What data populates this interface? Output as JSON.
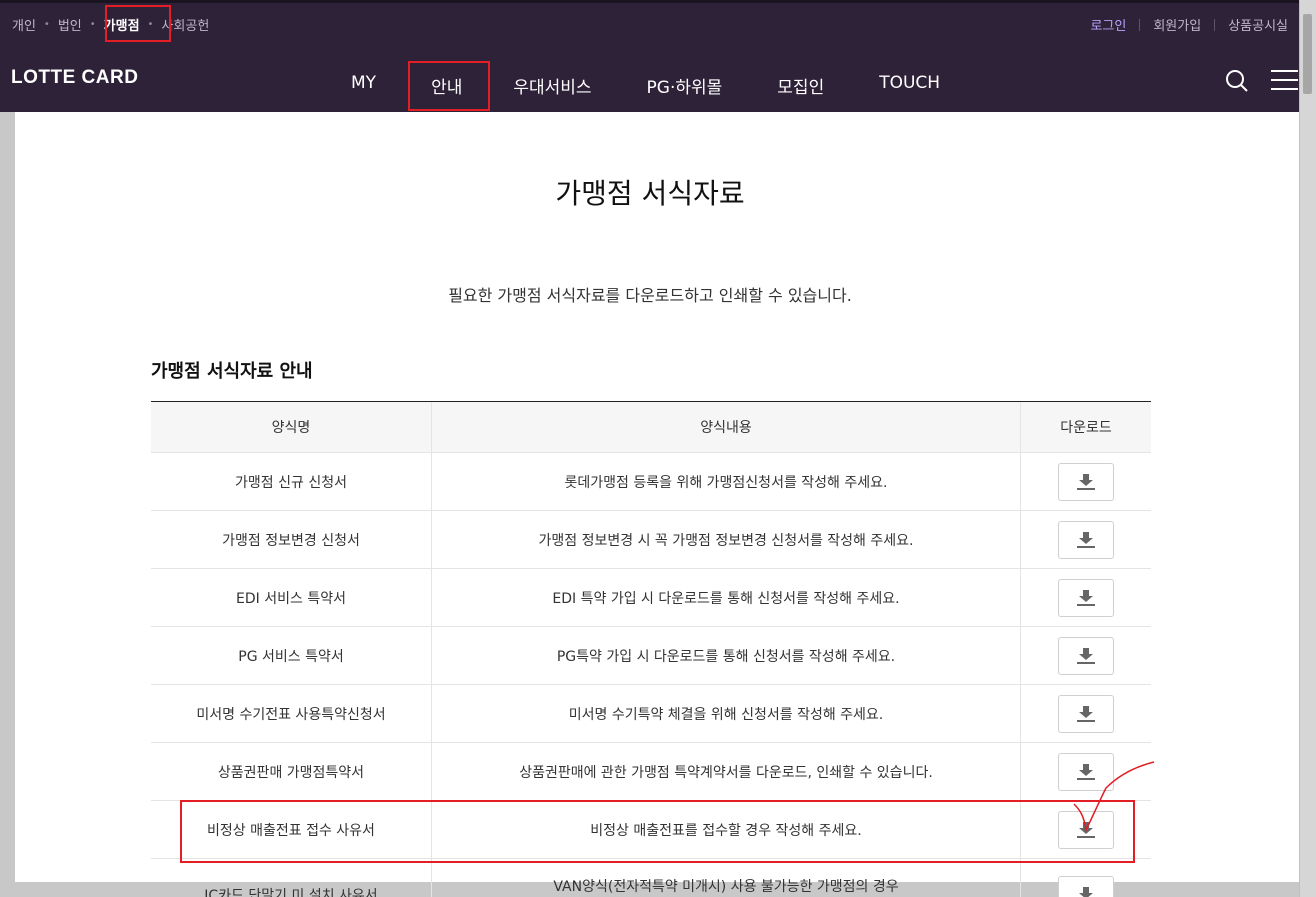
{
  "utility": {
    "left": [
      "개인",
      "법인",
      "가맹점",
      "사회공헌"
    ],
    "right": [
      "로그인",
      "회원가입",
      "상품공시실"
    ]
  },
  "logo": "LOTTE CARD",
  "gnb": [
    "MY",
    "안내",
    "우대서비스",
    "PG·하위몰",
    "모집인",
    "TOUCH"
  ],
  "page": {
    "title": "가맹점 서식자료",
    "description": "필요한 가맹점 서식자료를 다운로드하고 인쇄할 수 있습니다.",
    "section_title": "가맹점 서식자료 안내"
  },
  "table": {
    "headers": [
      "양식명",
      "양식내용",
      "다운로드"
    ],
    "rows": [
      {
        "name": "가맹점 신규 신청서",
        "content": "롯데가맹점 등록을 위해 가맹점신청서를 작성해 주세요."
      },
      {
        "name": "가맹점 정보변경 신청서",
        "content": "가맹점 정보변경 시 꼭 가맹점 정보변경 신청서를 작성해 주세요."
      },
      {
        "name": "EDI 서비스 특약서",
        "content": "EDI 특약 가입 시 다운로드를 통해 신청서를 작성해 주세요."
      },
      {
        "name": "PG 서비스 특약서",
        "content": "PG특약 가입 시 다운로드를 통해 신청서를 작성해 주세요."
      },
      {
        "name": "미서명 수기전표 사용특약신청서",
        "content": "미서명 수기특약 체결을 위해 신청서를 작성해 주세요."
      },
      {
        "name": "상품권판매 가맹점특약서",
        "content": "상품권판매에 관한 가맹점 특약계약서를 다운로드, 인쇄할 수 있습니다."
      },
      {
        "name": "비정상 매출전표 접수 사유서",
        "content": "비정상 매출전표를 접수할 경우 작성해 주세요."
      }
    ],
    "partial_row": {
      "name": "IC카드 단말기 미 설치 사유서",
      "content": "VAN양식(전자적특약 미개시) 사용 불가능한 가맹점의 경우"
    }
  },
  "colors": {
    "header_bg": "#2e2238",
    "highlight": "#e31e24",
    "login_text": "#b9a3ff"
  }
}
